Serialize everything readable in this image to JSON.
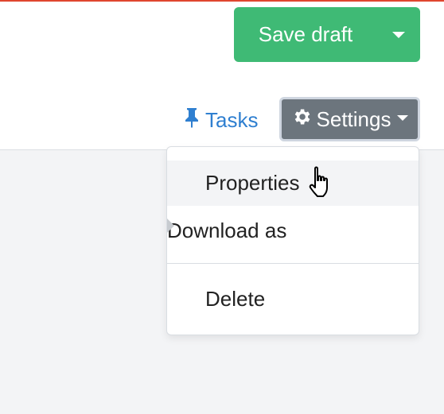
{
  "toolbar": {
    "save_label": "Save draft",
    "tasks_label": "Tasks",
    "settings_label": "Settings"
  },
  "settings_menu": {
    "items": [
      {
        "label": "Properties"
      },
      {
        "label": "Download as"
      },
      {
        "label": "Delete"
      }
    ]
  },
  "colors": {
    "save_button": "#3fba75",
    "settings_button": "#6c757d",
    "tasks_link": "#2f7fd0",
    "top_accent": "#e0462f"
  },
  "icons": {
    "tasks": "pin-icon",
    "settings": "gear-icon",
    "cursor": "hand-cursor-icon"
  }
}
